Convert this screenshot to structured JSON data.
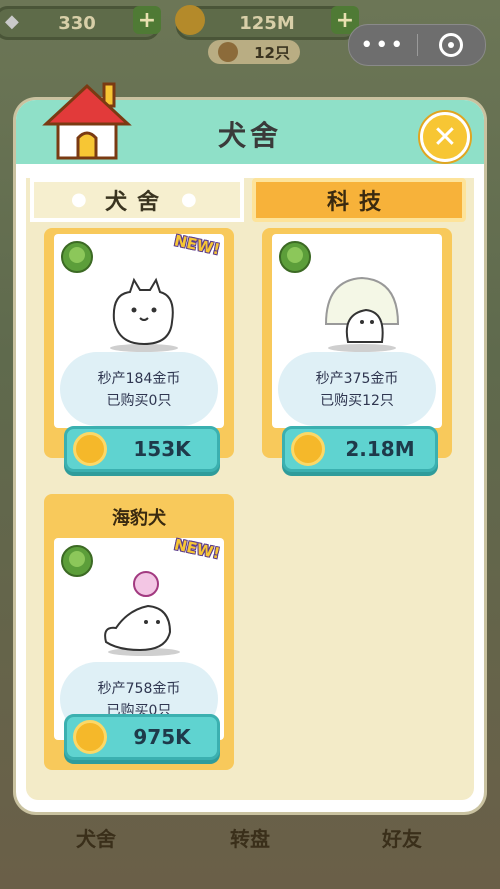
{
  "hud": {
    "gems": "330",
    "coins": "125M",
    "dog_count": "12只"
  },
  "modal": {
    "title": "犬舍",
    "close_label": "✕"
  },
  "tabs": [
    {
      "label": "犬舍",
      "active": true
    },
    {
      "label": "科技",
      "active": false
    }
  ],
  "cards": [
    {
      "rate": "秒产184金币",
      "bought": "已购买0只",
      "price": "153K",
      "badge": "NEW!"
    },
    {
      "rate": "秒产375金币",
      "bought": "已购买12只",
      "price": "2.18M",
      "badge": ""
    },
    {
      "title": "海豹犬",
      "rate": "秒产758金币",
      "bought": "已购买0只",
      "price": "975K",
      "badge": "NEW!"
    }
  ],
  "bottom_nav": [
    {
      "label": "犬舍"
    },
    {
      "label": "转盘"
    },
    {
      "label": "好友"
    }
  ],
  "colors": {
    "header": "#8fe0c8",
    "card": "#f8c95b",
    "price_button": "#5fd3d0",
    "close": "#f7c634"
  }
}
